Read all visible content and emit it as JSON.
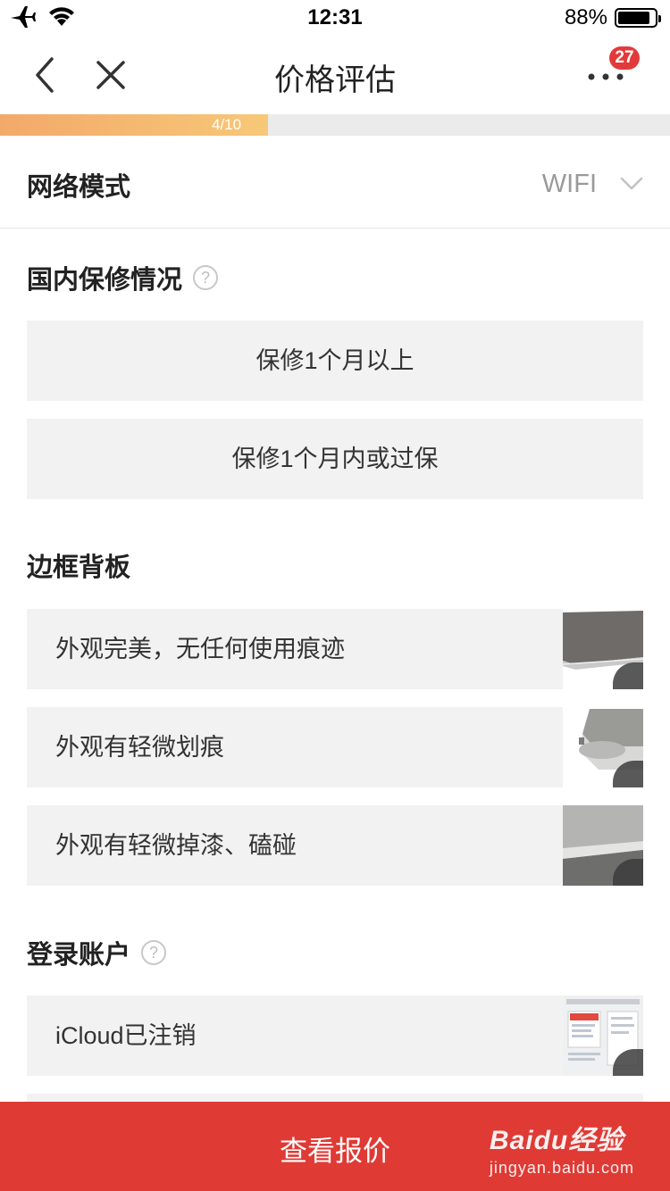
{
  "status_bar": {
    "time": "12:31",
    "battery_text": "88%",
    "battery_level": 0.88,
    "left_icons": [
      "airplane-icon",
      "wifi-icon"
    ]
  },
  "nav": {
    "title": "价格评估",
    "badge_count": "27",
    "icons": [
      "back-icon",
      "close-icon",
      "more-icon"
    ]
  },
  "progress": {
    "label": "4/10",
    "fraction": 0.4,
    "fill_colors": [
      "#f3a96a",
      "#f7c878"
    ]
  },
  "network": {
    "label": "网络模式",
    "value": "WIFI"
  },
  "warranty": {
    "title": "国内保修情况",
    "help": "?",
    "options": [
      {
        "label": "保修1个月以上"
      },
      {
        "label": "保修1个月内或过保"
      }
    ]
  },
  "frame": {
    "title": "边框背板",
    "options": [
      {
        "label": "外观完美，无任何使用痕迹"
      },
      {
        "label": "外观有轻微划痕"
      },
      {
        "label": "外观有轻微掉漆、磕碰"
      }
    ]
  },
  "account": {
    "title": "登录账户",
    "help": "?",
    "options": [
      {
        "label": "iCloud已注销"
      }
    ]
  },
  "bottom": {
    "button_label": "查看报价",
    "watermark_logo": "Baidu经验",
    "watermark_url": "jingyan.baidu.com",
    "color": "#df3a34"
  }
}
